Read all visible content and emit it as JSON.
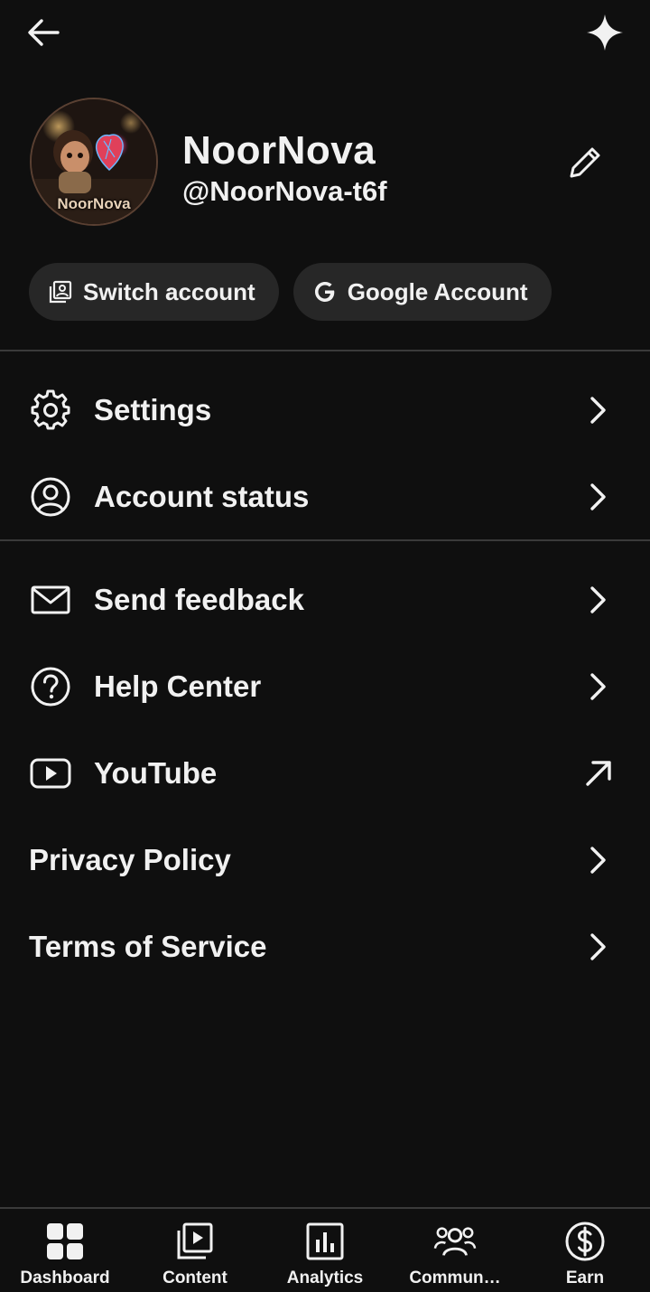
{
  "header": {
    "back_icon": "arrow-left-icon",
    "sparkle_icon": "sparkle-icon"
  },
  "profile": {
    "avatar_text": "NoorNova",
    "name": "NoorNova",
    "handle": "@NoorNova-t6f",
    "edit_icon": "pencil-icon"
  },
  "chips": [
    {
      "label": "Switch account",
      "icon": "switch-account-icon"
    },
    {
      "label": "Google Account",
      "icon": "google-g-icon"
    }
  ],
  "menu": [
    {
      "label": "Settings",
      "icon": "gear-icon",
      "trailing": "chevron-right-icon"
    },
    {
      "label": "Account status",
      "icon": "person-circle-icon",
      "trailing": "chevron-right-icon"
    },
    {
      "label": "Send feedback",
      "icon": "mail-icon",
      "trailing": "chevron-right-icon"
    },
    {
      "label": "Help Center",
      "icon": "help-circle-icon",
      "trailing": "chevron-right-icon"
    },
    {
      "label": "YouTube",
      "icon": "youtube-play-icon",
      "trailing": "external-link-arrow-icon"
    },
    {
      "label": "Privacy Policy",
      "trailing": "chevron-right-icon"
    },
    {
      "label": "Terms of Service",
      "trailing": "chevron-right-icon"
    }
  ],
  "bottom_nav": [
    {
      "label": "Dashboard",
      "icon": "dashboard-grid-icon"
    },
    {
      "label": "Content",
      "icon": "content-play-icon"
    },
    {
      "label": "Analytics",
      "icon": "analytics-bars-icon"
    },
    {
      "label": "Commun…",
      "icon": "community-people-icon"
    },
    {
      "label": "Earn",
      "icon": "dollar-circle-icon"
    }
  ],
  "colors": {
    "background": "#0f0f0f",
    "chip_background": "#272727",
    "divider": "#3a3a3a",
    "text": "#f1f1f1"
  }
}
